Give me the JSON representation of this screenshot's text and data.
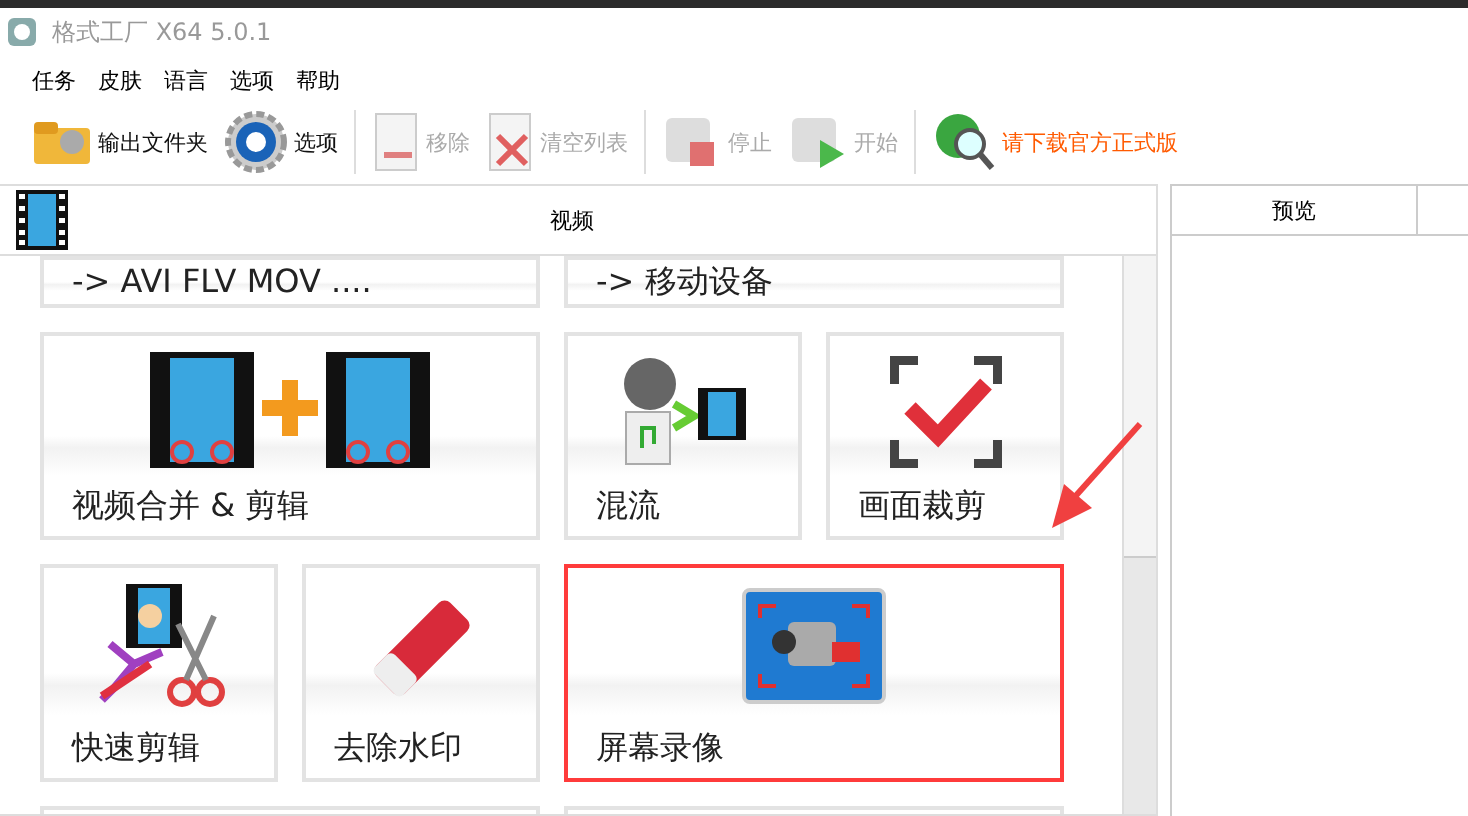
{
  "window": {
    "title": "格式工厂 X64 5.0.1"
  },
  "menu": [
    "任务",
    "皮肤",
    "语言",
    "选项",
    "帮助"
  ],
  "toolbar": [
    {
      "label": "输出文件夹",
      "kind": "folder",
      "disabled": false
    },
    {
      "label": "选项",
      "kind": "gear",
      "disabled": false
    },
    {
      "label": "移除",
      "kind": "remove",
      "disabled": true
    },
    {
      "label": "清空列表",
      "kind": "clear",
      "disabled": true
    },
    {
      "label": "停止",
      "kind": "stop",
      "disabled": true
    },
    {
      "label": "开始",
      "kind": "start",
      "disabled": true
    },
    {
      "label": "请下载官方正式版",
      "kind": "globe",
      "disabled": false
    }
  ],
  "panel": {
    "title": "视频"
  },
  "tiles": [
    {
      "label": "-> AVI FLV MOV ....",
      "kind": "partial",
      "highlighted": false
    },
    {
      "label": "-> 移动设备",
      "kind": "partial",
      "highlighted": false
    },
    {
      "label": "视频合并 & 剪辑",
      "kind": "merge",
      "highlighted": false
    },
    {
      "label": "混流",
      "kind": "mux",
      "highlighted": false
    },
    {
      "label": "画面裁剪",
      "kind": "crop",
      "highlighted": false
    },
    {
      "label": "快速剪辑",
      "kind": "quickcut",
      "highlighted": false
    },
    {
      "label": "去除水印",
      "kind": "eraser",
      "highlighted": false
    },
    {
      "label": "屏幕录像",
      "kind": "record",
      "highlighted": true
    }
  ],
  "preview": {
    "columns": [
      "预览"
    ]
  }
}
